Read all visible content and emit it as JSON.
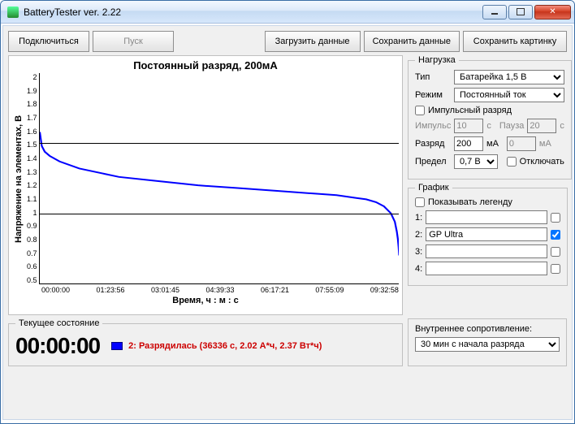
{
  "window": {
    "title": "BatteryTester ver. 2.22"
  },
  "toolbar": {
    "connect": "Подключиться",
    "start": "Пуск",
    "load": "Загрузить данные",
    "save": "Сохранить данные",
    "savepic": "Сохранить картинку"
  },
  "chart_data": {
    "type": "line",
    "title": "Постоянный разряд, 200мА",
    "xlabel": "Время, ч : м : с",
    "ylabel": "Напряжение на элементах, В",
    "ylim": [
      0.5,
      2.0
    ],
    "yticks": [
      2.0,
      1.9,
      1.8,
      1.7,
      1.6,
      1.5,
      1.4,
      1.3,
      1.2,
      1.1,
      1.0,
      0.9,
      0.8,
      0.7,
      0.6,
      0.5
    ],
    "xticks": [
      "00:00:00",
      "01:23:56",
      "03:01:45",
      "04:39:33",
      "06:17:21",
      "07:55:09",
      "09:32:58"
    ],
    "grid_h_at": [
      2.0,
      1.5,
      1.0,
      0.5
    ],
    "series": [
      {
        "name": "GP Ultra",
        "color": "#0000ff",
        "x": [
          0,
          200,
          500,
          1000,
          2000,
          4000,
          8000,
          12000,
          16000,
          20000,
          24000,
          28000,
          30000,
          32000,
          33000,
          34000,
          34800,
          35500,
          35900,
          36100,
          36200,
          36280,
          36336
        ],
        "y": [
          1.58,
          1.48,
          1.44,
          1.41,
          1.37,
          1.32,
          1.26,
          1.23,
          1.2,
          1.18,
          1.16,
          1.14,
          1.13,
          1.11,
          1.1,
          1.08,
          1.05,
          1.0,
          0.94,
          0.87,
          0.82,
          0.76,
          0.7
        ]
      }
    ],
    "x_range_seconds": [
      0,
      36336
    ]
  },
  "load_panel": {
    "legend": "Нагрузка",
    "type_label": "Тип",
    "type_value": "Батарейка 1,5 В",
    "mode_label": "Режим",
    "mode_value": "Постоянный ток",
    "pulse_chk": "Импульсный разряд",
    "imp_label": "Импульс",
    "imp_value": "10",
    "imp_unit": "с",
    "pause_label": "Пауза",
    "pause_value": "20",
    "pause_unit": "с",
    "disch_label": "Разряд",
    "disch_value": "200",
    "disch_unit": "мА",
    "disch2_value": "0",
    "disch2_unit": "мА",
    "limit_label": "Предел",
    "limit_value": "0,7 В",
    "off_chk": "Отключать"
  },
  "graph_panel": {
    "legend": "График",
    "show_legend": "Показывать легенду",
    "rows": {
      "r1_label": "1:",
      "r1_value": "",
      "r2_label": "2:",
      "r2_value": "GP Ultra",
      "r3_label": "3:",
      "r3_value": "",
      "r4_label": "4:",
      "r4_value": ""
    },
    "r2_checked": true
  },
  "status": {
    "legend": "Текущее состояние",
    "time": "00:00:00",
    "text": "2: Разрядилась (36336 с, 2.02 А*ч, 2.37 Вт*ч)"
  },
  "ir": {
    "label": "Внутреннее сопротивление:",
    "select": "30 мин с начала разряда"
  }
}
